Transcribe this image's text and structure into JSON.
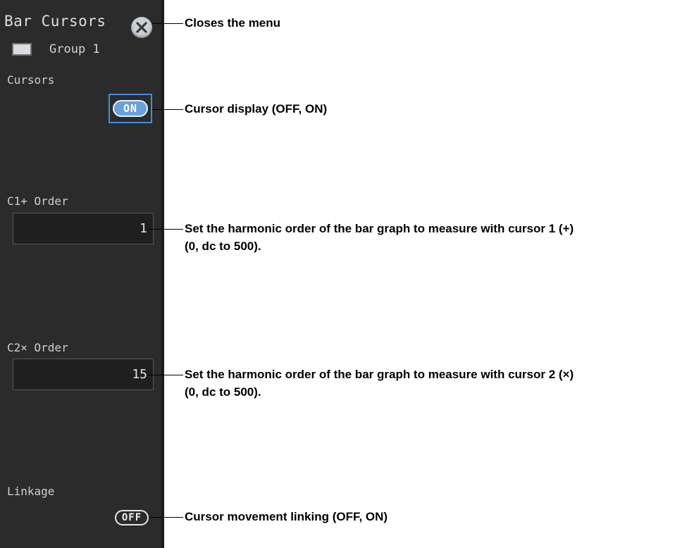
{
  "menu": {
    "title": "Bar Cursors",
    "group_label": "Group 1",
    "cursors": {
      "label": "Cursors",
      "state": "ON"
    },
    "c1_order": {
      "label": "C1+ Order",
      "value": "1"
    },
    "c2_order": {
      "label": "C2× Order",
      "value": "15"
    },
    "linkage": {
      "label": "Linkage",
      "state": "OFF"
    }
  },
  "callouts": {
    "close": "Closes the menu",
    "cursor_display": "Cursor display (OFF, ON)",
    "c1_line1": "Set the harmonic order of the bar graph to measure with cursor 1 (+)",
    "c1_line2": "(0, dc to 500).",
    "c2_line1": "Set the harmonic order of the bar graph to measure with cursor 2 (×)",
    "c2_line2": "(0, dc to 500).",
    "linkage": "Cursor movement linking (OFF, ON)"
  }
}
